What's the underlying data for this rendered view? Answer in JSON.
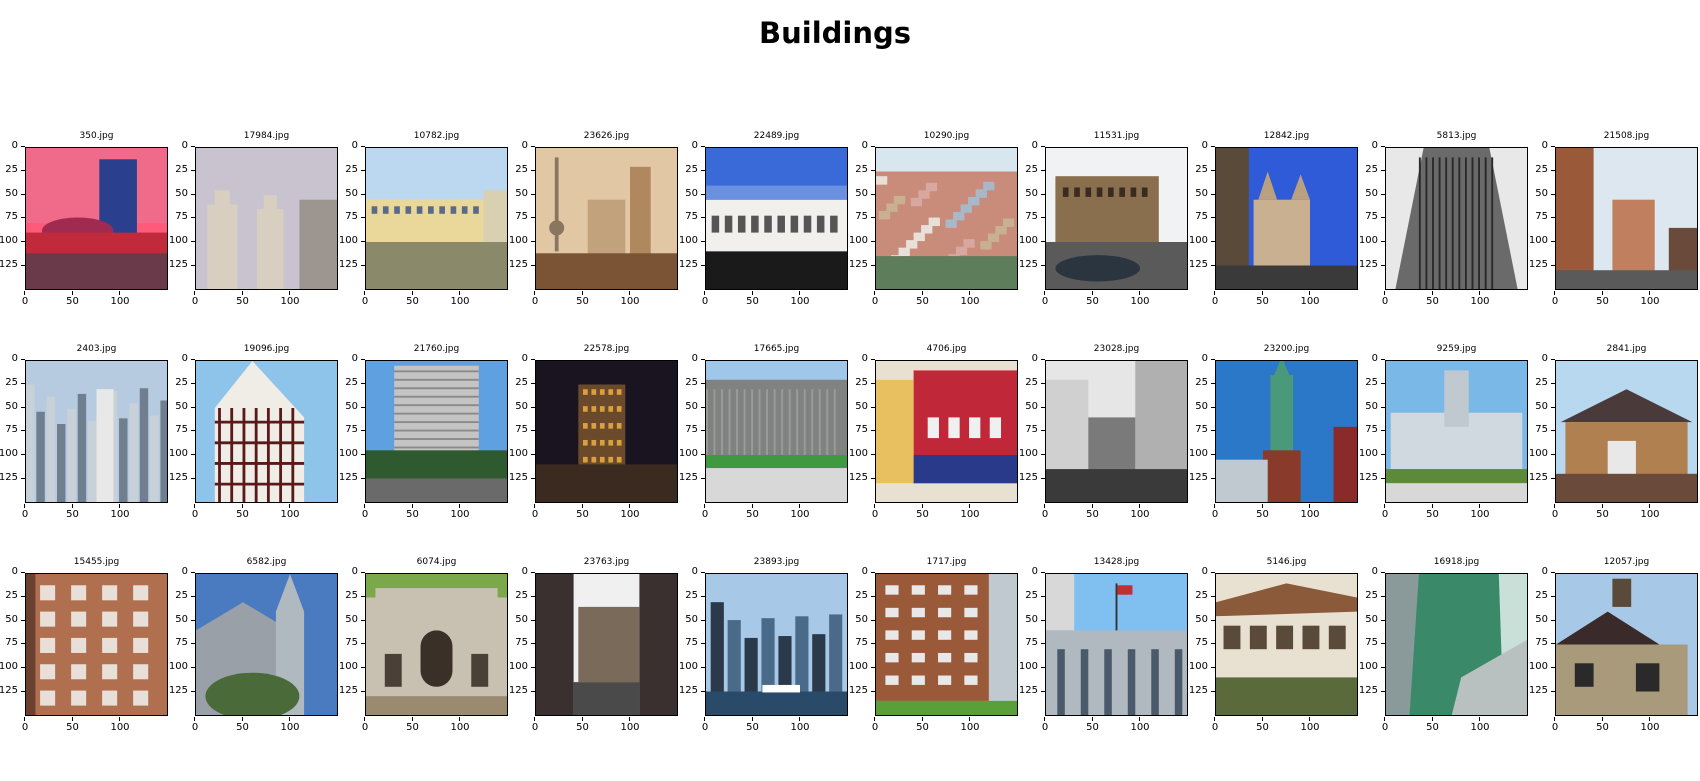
{
  "chart_data": {
    "type": "image-grid",
    "title": "Buildings",
    "rows": 3,
    "cols": 10,
    "image_size": [
      150,
      150
    ],
    "xticks": [
      "0",
      "50",
      "100"
    ],
    "yticks": [
      "0",
      "25",
      "50",
      "75",
      "100",
      "125"
    ],
    "images": [
      {
        "filename": "350.jpg",
        "scene": "modern-tower-dusk",
        "palette": [
          "#ff5a7a",
          "#2b3f8f",
          "#c02a3a"
        ]
      },
      {
        "filename": "17984.jpg",
        "scene": "stepped-towers",
        "palette": [
          "#c9c3cf",
          "#d9cfc0",
          "#9c9590"
        ]
      },
      {
        "filename": "10782.jpg",
        "scene": "apartment-block",
        "palette": [
          "#bcd8f0",
          "#e9d89a",
          "#8a8a6a"
        ]
      },
      {
        "filename": "23626.jpg",
        "scene": "minaret-and-tower",
        "palette": [
          "#e2c7a4",
          "#b0885f",
          "#7b5435"
        ]
      },
      {
        "filename": "22489.jpg",
        "scene": "arcade-building",
        "palette": [
          "#3a6ad8",
          "#f2f0ec",
          "#1a1a1a"
        ]
      },
      {
        "filename": "10290.jpg",
        "scene": "hillside-city",
        "palette": [
          "#d8e6f0",
          "#c98b7a",
          "#5e7d5a"
        ]
      },
      {
        "filename": "11531.jpg",
        "scene": "old-corner-building",
        "palette": [
          "#f1f2f3",
          "#8a6f4f",
          "#2b3540"
        ]
      },
      {
        "filename": "12842.jpg",
        "scene": "gothic-street",
        "palette": [
          "#2f5bd8",
          "#5a4a3a",
          "#3a3a3a"
        ]
      },
      {
        "filename": "5813.jpg",
        "scene": "skyscraper-bw",
        "palette": [
          "#e8e8e8",
          "#6a6a6a",
          "#2a2a2a"
        ]
      },
      {
        "filename": "21508.jpg",
        "scene": "brick-street",
        "palette": [
          "#dde7ef",
          "#9a5a3a",
          "#6a4a3a"
        ]
      },
      {
        "filename": "2403.jpg",
        "scene": "city-skyline",
        "palette": [
          "#b7cbe0",
          "#6f7f90",
          "#2f3f4f"
        ]
      },
      {
        "filename": "19096.jpg",
        "scene": "half-timbered-house",
        "palette": [
          "#8ec3ea",
          "#f0ece6",
          "#5a1a1a"
        ]
      },
      {
        "filename": "21760.jpg",
        "scene": "highrise-trees",
        "palette": [
          "#5fa0e0",
          "#c4c4c4",
          "#2f5a2f"
        ]
      },
      {
        "filename": "22578.jpg",
        "scene": "city-night",
        "palette": [
          "#1a1420",
          "#d9a040",
          "#3a2a20"
        ]
      },
      {
        "filename": "17665.jpg",
        "scene": "concrete-building",
        "palette": [
          "#9ec7ea",
          "#7f8280",
          "#3f9a3f"
        ]
      },
      {
        "filename": "4706.jpg",
        "scene": "red-storefront",
        "palette": [
          "#c0283a",
          "#2a3a8a",
          "#e8c060"
        ]
      },
      {
        "filename": "23028.jpg",
        "scene": "street-towers",
        "palette": [
          "#e6e6e6",
          "#7a7a7a",
          "#3a3a3a"
        ]
      },
      {
        "filename": "23200.jpg",
        "scene": "church-spire",
        "palette": [
          "#2c78c8",
          "#4a9a7a",
          "#c0c8d0"
        ]
      },
      {
        "filename": "9259.jpg",
        "scene": "chateau",
        "palette": [
          "#7ab8e8",
          "#d0d8e0",
          "#5a8a3a"
        ]
      },
      {
        "filename": "2841.jpg",
        "scene": "brick-house",
        "palette": [
          "#b8d8f0",
          "#b08050",
          "#6a4a3a"
        ]
      },
      {
        "filename": "15455.jpg",
        "scene": "brick-facade",
        "palette": [
          "#b07050",
          "#6a4030",
          "#d8c0b0"
        ]
      },
      {
        "filename": "6582.jpg",
        "scene": "stone-church",
        "palette": [
          "#4a7ac0",
          "#9aa0a8",
          "#4a6a3a"
        ]
      },
      {
        "filename": "6074.jpg",
        "scene": "triumphal-arch",
        "palette": [
          "#c8c0b0",
          "#9a8a70",
          "#5a7a3a"
        ]
      },
      {
        "filename": "23763.jpg",
        "scene": "street-canyon",
        "palette": [
          "#f0f0f0",
          "#7a6a5a",
          "#3a3030"
        ]
      },
      {
        "filename": "23893.jpg",
        "scene": "harbor-skyline",
        "palette": [
          "#a8c8e8",
          "#4a6a8a",
          "#2a3a4a"
        ]
      },
      {
        "filename": "1717.jpg",
        "scene": "brick-apartments",
        "palette": [
          "#9a5a3a",
          "#6a3a2a",
          "#5aa03a"
        ]
      },
      {
        "filename": "13428.jpg",
        "scene": "classical-facade",
        "palette": [
          "#80c0f0",
          "#b0b8c0",
          "#4a5a6a"
        ]
      },
      {
        "filename": "5146.jpg",
        "scene": "shophouses",
        "palette": [
          "#e8e0d0",
          "#8a5a3a",
          "#5a6a3a"
        ]
      },
      {
        "filename": "16918.jpg",
        "scene": "glass-tower",
        "palette": [
          "#c8e0d8",
          "#3a8a6a",
          "#8a9a9a"
        ]
      },
      {
        "filename": "12057.jpg",
        "scene": "stone-cottage",
        "palette": [
          "#a8c8e8",
          "#a89a7a",
          "#2a2a2a"
        ]
      }
    ]
  }
}
